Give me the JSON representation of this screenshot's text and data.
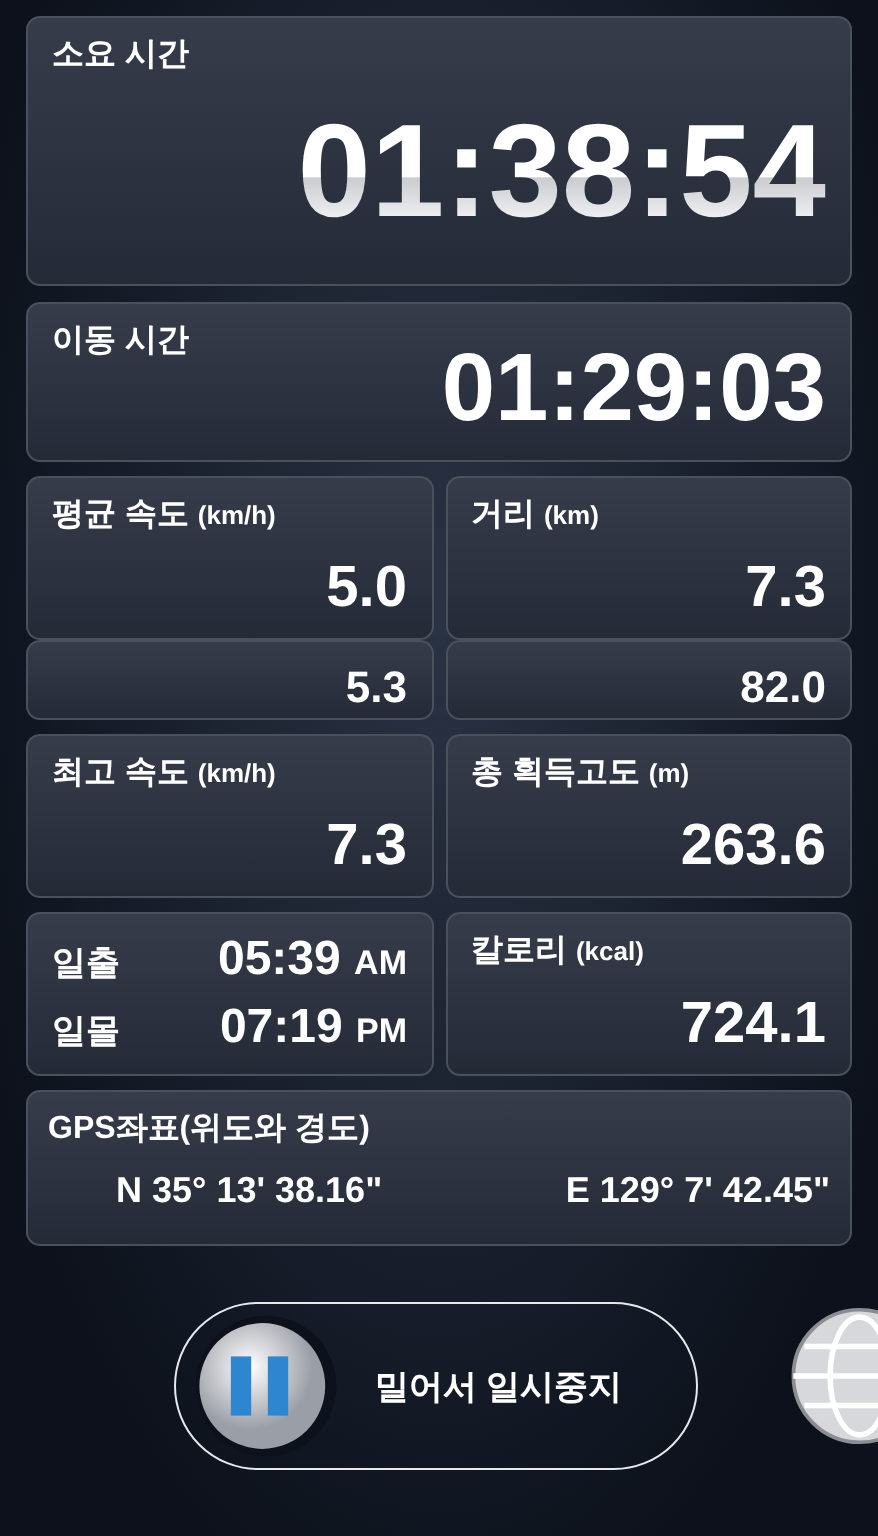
{
  "elapsed": {
    "label": "소요 시간",
    "value": "01:38:54"
  },
  "moving": {
    "label": "이동 시간",
    "value": "01:29:03"
  },
  "stats_top": [
    {
      "label": "평균 속도",
      "unit": "(km/h)",
      "value": "5.0"
    },
    {
      "label": "거리",
      "unit": "(km)",
      "value": "7.3"
    }
  ],
  "stats_partial": [
    "5.3",
    "82.0"
  ],
  "stats_mid": [
    {
      "label": "최고 속도",
      "unit": "(km/h)",
      "value": "7.3"
    },
    {
      "label": "총 획득고도",
      "unit": "(m)",
      "value": "263.6"
    }
  ],
  "sun": [
    {
      "label": "일출",
      "time": "05:39",
      "ampm": "AM"
    },
    {
      "label": "일몰",
      "time": "07:19",
      "ampm": "PM"
    }
  ],
  "calories": {
    "label": "칼로리",
    "unit": "(kcal)",
    "value": "724.1"
  },
  "gps": {
    "label": "GPS좌표(위도와 경도)",
    "lat": "N 35° 13' 38.16\"",
    "lon": "E 129° 7' 42.45\""
  },
  "slider": {
    "label": "밀어서 일시중지",
    "level": 0
  }
}
